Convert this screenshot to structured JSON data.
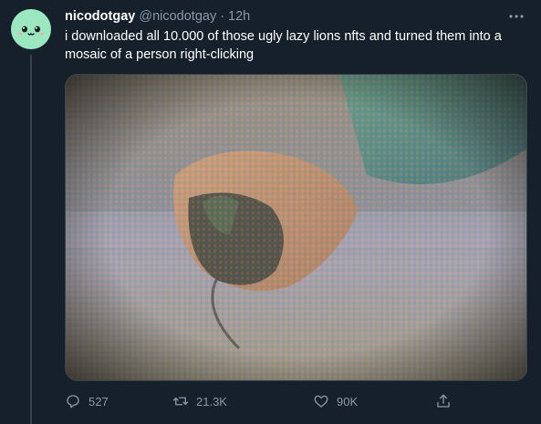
{
  "tweet": {
    "display_name": "nicodotgay",
    "handle": "@nicodotgay",
    "separator": "·",
    "time": "12h",
    "text": "i downloaded all 10.000 of those ugly lazy lions nfts and turned them into a mosaic of a person right-clicking",
    "avatar": {
      "color": "#9be8c0",
      "icon": "smiley-face-icon"
    },
    "media": {
      "description_icon": "mosaic-photo-icon"
    }
  },
  "actions": {
    "reply": {
      "icon": "reply-icon",
      "count": "527"
    },
    "retweet": {
      "icon": "retweet-icon",
      "count": "21.3K"
    },
    "like": {
      "icon": "heart-icon",
      "count": "90K"
    },
    "share": {
      "icon": "share-icon"
    }
  },
  "colors": {
    "background": "#15202b",
    "secondary_text": "#8899a6",
    "border": "#38444d"
  }
}
